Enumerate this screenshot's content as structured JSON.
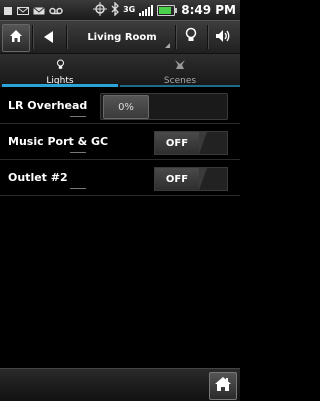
{
  "status_bar": {
    "time": "8:49 PM",
    "network": "3G",
    "icons": [
      "notification-square-icon",
      "mail-icon",
      "mail-icon",
      "voicemail-icon",
      "gps-icon",
      "bluetooth-icon",
      "signal-icon",
      "battery-icon"
    ]
  },
  "header": {
    "room": "Living Room",
    "icons": [
      "home-icon",
      "back-arrow-icon",
      "lightbulb-icon",
      "volume-icon"
    ]
  },
  "tabs": [
    {
      "label": "Lights",
      "icon": "lightbulb-icon",
      "active": true
    },
    {
      "label": "Scenes",
      "icon": "scenes-icon",
      "active": false
    }
  ],
  "devices": [
    {
      "name": "LR Overhead",
      "control": "slider",
      "value": "0%",
      "level": 0
    },
    {
      "name": "Music Port & GC",
      "control": "toggle",
      "value": "OFF"
    },
    {
      "name": "Outlet #2",
      "control": "toggle",
      "value": "OFF"
    }
  ],
  "colors": {
    "accent": "#2aa4d6",
    "background": "#000000"
  },
  "bottom_bar": {
    "icons": [
      "house-icon"
    ]
  }
}
